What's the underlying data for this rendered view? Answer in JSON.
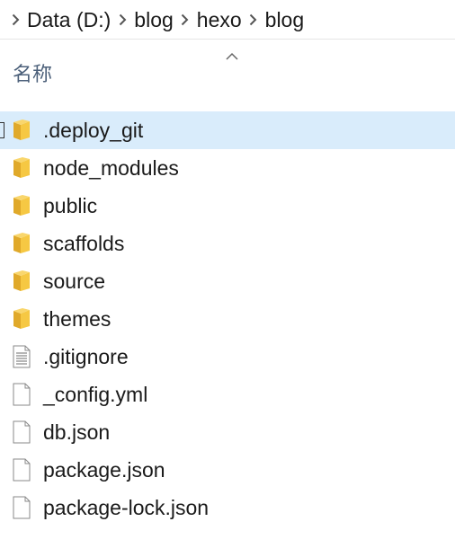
{
  "breadcrumb": {
    "items": [
      "Data (D:)",
      "blog",
      "hexo",
      "blog"
    ]
  },
  "header": {
    "name_column": "名称"
  },
  "files": [
    {
      "name": ".deploy_git",
      "type": "folder",
      "selected": true
    },
    {
      "name": "node_modules",
      "type": "folder"
    },
    {
      "name": "public",
      "type": "folder"
    },
    {
      "name": "scaffolds",
      "type": "folder"
    },
    {
      "name": "source",
      "type": "folder"
    },
    {
      "name": "themes",
      "type": "folder"
    },
    {
      "name": ".gitignore",
      "type": "text-file"
    },
    {
      "name": "_config.yml",
      "type": "file"
    },
    {
      "name": "db.json",
      "type": "file"
    },
    {
      "name": "package.json",
      "type": "file"
    },
    {
      "name": "package-lock.json",
      "type": "file"
    }
  ],
  "colors": {
    "selection": "#d9ecfb",
    "folder": "#f6c843",
    "header_text": "#4c607a"
  }
}
